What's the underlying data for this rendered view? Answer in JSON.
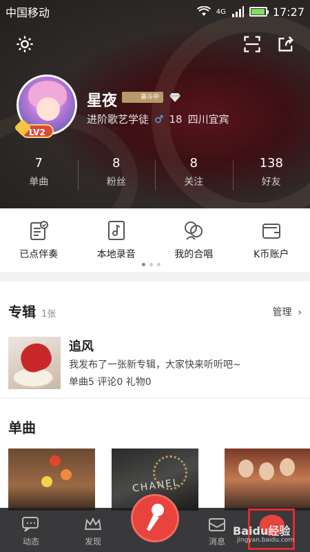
{
  "status_bar": {
    "carrier": "中国移动",
    "network": "4G",
    "time": "17:27",
    "battery_level": 0.85
  },
  "profile": {
    "name": "星夜",
    "rank_tag": "奋斗中",
    "level": "LV2",
    "title": "进阶歌艺学徒",
    "gender_icon": "male-icon",
    "age": "18",
    "location": "四川宜宾"
  },
  "stats": [
    {
      "value": "7",
      "label": "单曲"
    },
    {
      "value": "8",
      "label": "粉丝"
    },
    {
      "value": "8",
      "label": "关注"
    },
    {
      "value": "138",
      "label": "好友"
    }
  ],
  "actions": [
    {
      "label": "已点伴奏",
      "icon": "checklist-icon"
    },
    {
      "label": "本地录音",
      "icon": "music-file-icon"
    },
    {
      "label": "我的合唱",
      "icon": "duet-icon"
    },
    {
      "label": "K币账户",
      "icon": "wallet-icon"
    }
  ],
  "album": {
    "section_title": "专辑",
    "count": "1张",
    "manage_label": "管理",
    "name": "追风",
    "description": "我发布了一张新专辑，大家快来听听吧~",
    "meta": "单曲5 评论0 礼物0"
  },
  "singles": {
    "section_title": "单曲"
  },
  "tabbar": {
    "items": [
      {
        "label": "动态",
        "icon": "chat-icon"
      },
      {
        "label": "发现",
        "icon": "crown-icon"
      },
      {
        "label": "消息",
        "icon": "mail-icon"
      }
    ],
    "record_icon": "microphone-icon"
  },
  "watermark": {
    "text": "Baidu经验",
    "sub": "jingyan.baidu.com"
  },
  "colors": {
    "accent": "#e8433c",
    "highlight_box": "#e22d2d"
  }
}
